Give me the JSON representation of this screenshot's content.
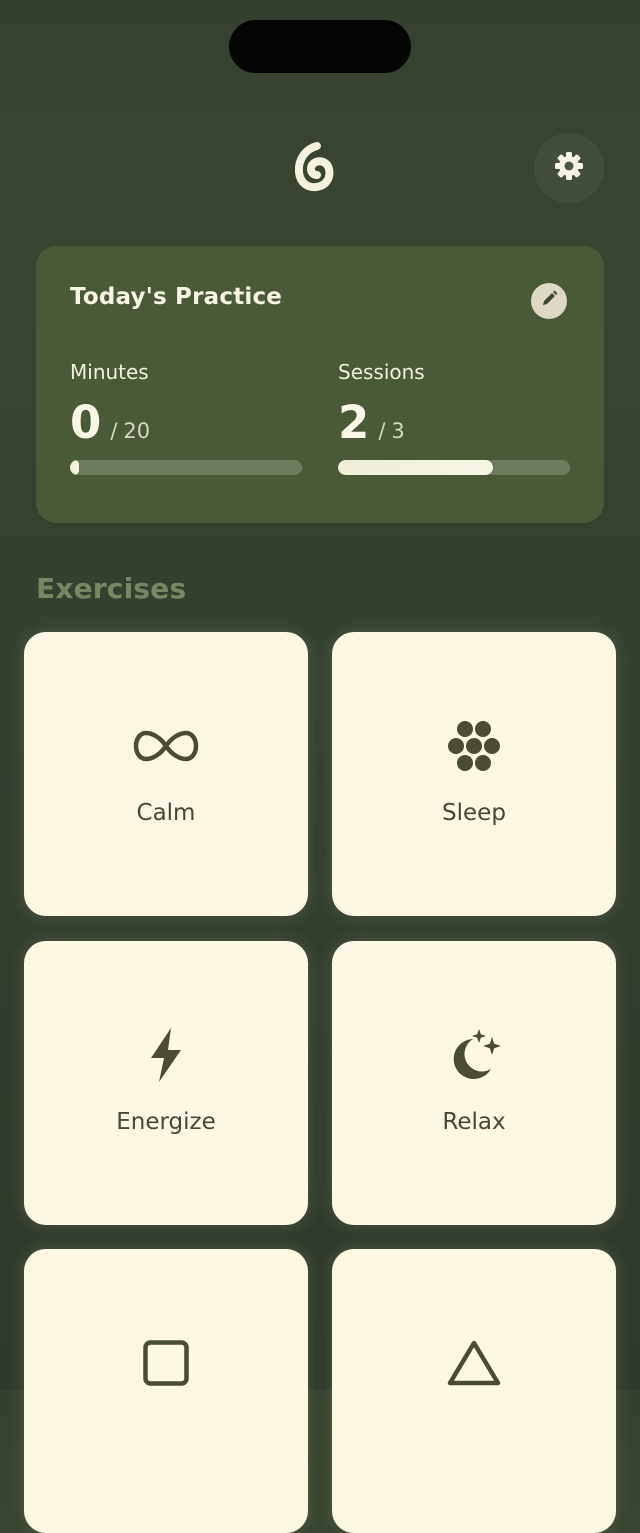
{
  "header": {
    "logo_icon": "spiral-logo-icon",
    "settings_icon": "gear-icon"
  },
  "practice": {
    "title": "Today's Practice",
    "edit_icon": "pencil-icon",
    "minutes": {
      "label": "Minutes",
      "current": "0",
      "separator": "/",
      "goal": "20",
      "progress": 0.0
    },
    "sessions": {
      "label": "Sessions",
      "current": "2",
      "separator": "/",
      "goal": "3",
      "progress": 0.67
    }
  },
  "exercises": {
    "title": "Exercises",
    "items": [
      {
        "label": "Calm",
        "icon": "infinity-icon"
      },
      {
        "label": "Sleep",
        "icon": "flower-icon"
      },
      {
        "label": "Energize",
        "icon": "lightning-bolt-icon"
      },
      {
        "label": "Relax",
        "icon": "moon-stars-icon"
      },
      {
        "label": "",
        "icon": "square-icon"
      },
      {
        "label": "",
        "icon": "triangle-icon"
      }
    ]
  },
  "colors": {
    "background": "#343f30",
    "card": "#4a5a38",
    "tile": "#fdf8e3",
    "icon": "#4a4d33",
    "accent": "#f7f6e7"
  }
}
